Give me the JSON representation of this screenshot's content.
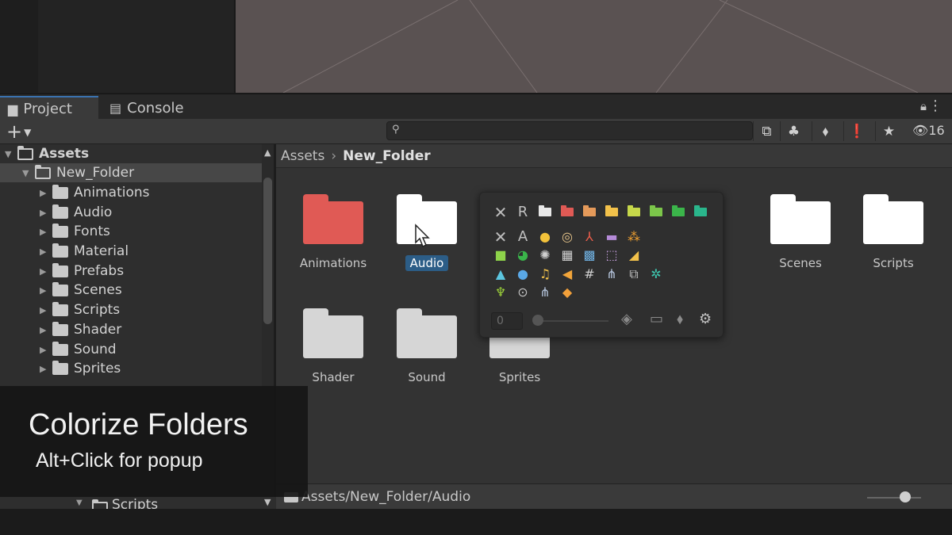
{
  "tabs": [
    {
      "label": "Project",
      "icon": "folder-icon"
    },
    {
      "label": "Console",
      "icon": "console-icon"
    }
  ],
  "toolbar": {
    "add_label": "+",
    "search_placeholder": "",
    "visible_count": "16"
  },
  "tree": {
    "root": "Assets",
    "selected": "New_Folder",
    "children": [
      "Animations",
      "Audio",
      "Fonts",
      "Material",
      "Prefabs",
      "Scenes",
      "Scripts",
      "Shader",
      "Sound",
      "Sprites"
    ],
    "partial_bottom": "Scripts"
  },
  "breadcrumb": [
    "Assets",
    "New_Folder"
  ],
  "grid": [
    {
      "label": "Animations",
      "color": "#e05a55"
    },
    {
      "label": "Audio",
      "color": "#ffffff",
      "selected": true
    },
    {
      "label": "Scenes",
      "color": "#ffffff"
    },
    {
      "label": "Scripts",
      "color": "#ffffff"
    },
    {
      "label": "Shader",
      "color": "#d6d6d6"
    },
    {
      "label": "Sound",
      "color": "#d6d6d6"
    },
    {
      "label": "Sprites",
      "color": "#d6d6d6"
    }
  ],
  "popup": {
    "reset_label": "R",
    "text_icon_label": "A",
    "value": "0",
    "folder_colors": [
      "#e8e8e8",
      "#e05a55",
      "#e59a5a",
      "#f2c14a",
      "#c6d84a",
      "#7cc64a",
      "#3bb54a",
      "#2ab68c"
    ]
  },
  "path": "Assets/New_Folder/Audio",
  "overlay": {
    "title": "Colorize Folders",
    "subtitle": "Alt+Click for popup"
  }
}
